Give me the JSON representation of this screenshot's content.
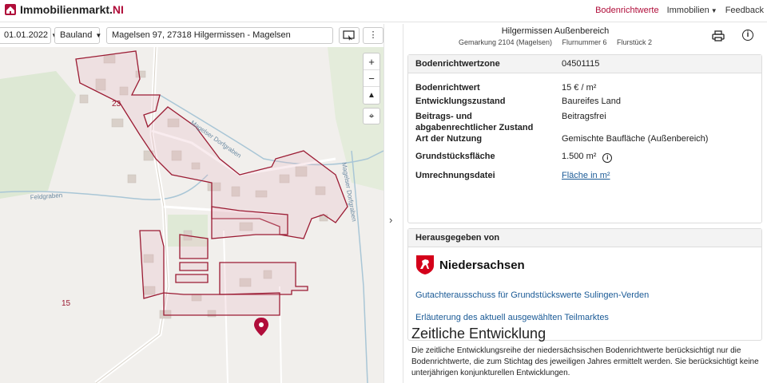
{
  "header": {
    "logo_text": "Immobilienmarkt.",
    "logo_tld": "NI",
    "nav": {
      "bodenrichtwerte": "Bodenrichtwerte",
      "immobilien": "Immobilien",
      "feedback": "Feedback"
    }
  },
  "toolbar": {
    "date": "01.01.2022",
    "type": "Bauland",
    "address": "Magelsen 97, 27318 Hilgermissen - Magelsen"
  },
  "map": {
    "zoom_in": "+",
    "zoom_out": "−",
    "labels": {
      "zone_23": "23",
      "zone_15": "15",
      "road_magelser_dorfgraben_1": "Magelser Dorfgraben",
      "road_magelser_dorfgraben_2": "Magelser Dorfgraben",
      "road_feldgraben": "Feldgraben"
    }
  },
  "panel": {
    "title": "Hilgermissen Außenbereich",
    "gemarkung": "Gemarkung 2104 (Magelsen)",
    "flurnummer": "Flurnummer 6",
    "flurstueck": "Flurstück 2",
    "zone": {
      "label": "Bodenrichtwertzone",
      "value": "04501115"
    },
    "rows": [
      {
        "label": "Bodenrichtwert",
        "value": "15 € / m²"
      },
      {
        "label": "Entwicklungszustand",
        "value": "Baureifes Land"
      },
      {
        "label": "Beitrags- und abgabenrechtlicher Zustand",
        "value": "Beitragsfrei"
      },
      {
        "label": "Art der Nutzung",
        "value": "Gemischte Baufläche (Außenbereich)"
      },
      {
        "label": "Grundstücksfläche",
        "value": "1.500 m²"
      },
      {
        "label": "Umrechnungsdatei",
        "value": "Fläche in m²"
      }
    ],
    "publisher": {
      "heading": "Herausgegeben von",
      "logo_text": "Niedersachsen",
      "link1": "Gutachterausschuss für Grundstückswerte Sulingen-Verden",
      "link2": "Erläuterung des aktuell ausgewählten Teilmarktes"
    },
    "history": {
      "title": "Zeitliche Entwicklung",
      "text": "Die zeitliche Entwicklungsreihe der niedersächsischen Bodenrichtwerte berücksichtigt nur die Bodenrichtwerte, die zum Stichtag des jeweiligen Jahres ermittelt werden. Sie berücksichtigt keine unterjährigen konjunkturellen Entwicklungen."
    }
  },
  "colors": {
    "brand": "#b00d3a",
    "link": "#1a5a96",
    "zone_border": "#9b1b33"
  }
}
